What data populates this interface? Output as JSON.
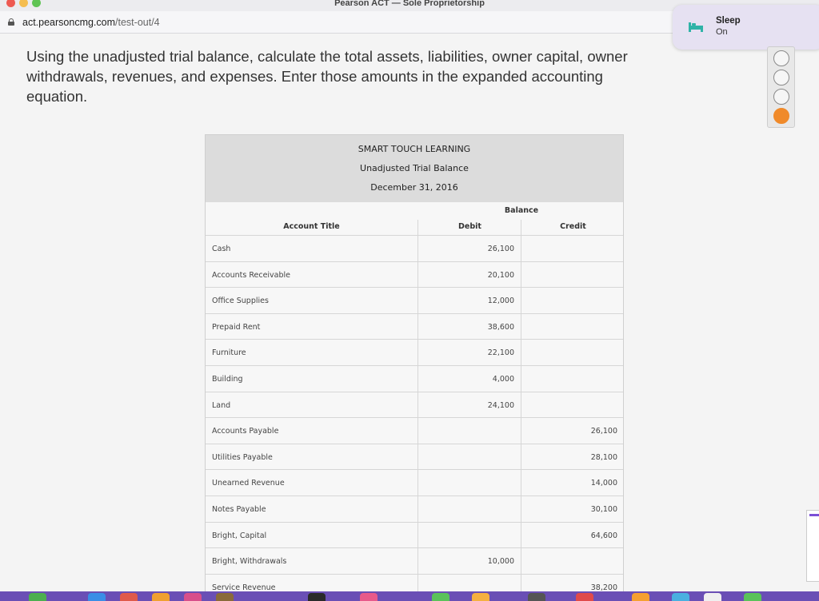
{
  "window": {
    "title": "Pearson ACT — Sole Proprietorship"
  },
  "browser": {
    "url_host": "act.pearsoncmg.com",
    "url_path": "/test-out/4"
  },
  "question": {
    "text": "Using the unadjusted trial balance, calculate the total assets, liabilities, owner capital, owner withdrawals, revenues, and expenses. Enter those amounts in the expanded accounting equation."
  },
  "trial_balance": {
    "company": "SMART TOUCH LEARNING",
    "report": "Unadjusted Trial Balance",
    "date": "December 31, 2016",
    "balance_label": "Balance",
    "col_account": "Account Title",
    "col_debit": "Debit",
    "col_credit": "Credit",
    "rows": [
      {
        "account": "Cash",
        "debit": "26,100",
        "credit": ""
      },
      {
        "account": "Accounts Receivable",
        "debit": "20,100",
        "credit": ""
      },
      {
        "account": "Office Supplies",
        "debit": "12,000",
        "credit": ""
      },
      {
        "account": "Prepaid Rent",
        "debit": "38,600",
        "credit": ""
      },
      {
        "account": "Furniture",
        "debit": "22,100",
        "credit": ""
      },
      {
        "account": "Building",
        "debit": "4,000",
        "credit": ""
      },
      {
        "account": "Land",
        "debit": "24,100",
        "credit": ""
      },
      {
        "account": "Accounts Payable",
        "debit": "",
        "credit": "26,100"
      },
      {
        "account": "Utilities Payable",
        "debit": "",
        "credit": "28,100"
      },
      {
        "account": "Unearned Revenue",
        "debit": "",
        "credit": "14,000"
      },
      {
        "account": "Notes Payable",
        "debit": "",
        "credit": "30,100"
      },
      {
        "account": "Bright, Capital",
        "debit": "",
        "credit": "64,600"
      },
      {
        "account": "Bright, Withdrawals",
        "debit": "10,000",
        "credit": ""
      },
      {
        "account": "Service Revenue",
        "debit": "",
        "credit": "38,200"
      }
    ]
  },
  "notification": {
    "title": "Sleep",
    "status": "On",
    "icon": "bed-icon"
  },
  "answer_options": {
    "count": 4,
    "selected_index": 3,
    "selected_color": "#f08a2a"
  },
  "colors": {
    "accent": "#f08a2a",
    "dock": "#6a4fb5",
    "sleep_icon": "#2fb3a7"
  }
}
